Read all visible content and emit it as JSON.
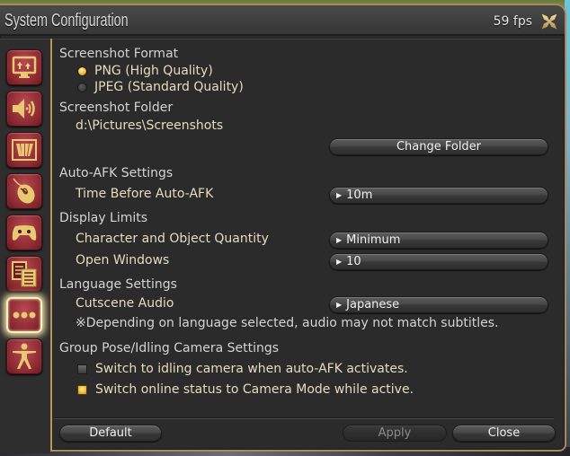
{
  "window": {
    "title": "System Configuration",
    "fps": "59 fps"
  },
  "sidebar": {
    "items": [
      {
        "name": "display-settings",
        "icon": "monitor-upload-icon",
        "active": false
      },
      {
        "name": "sound-settings",
        "icon": "speaker-icon",
        "active": false
      },
      {
        "name": "other-settings",
        "icon": "cards-icon",
        "active": false
      },
      {
        "name": "mouse-settings",
        "icon": "mouse-icon",
        "active": false
      },
      {
        "name": "gamepad-settings",
        "icon": "gamepad-icon",
        "active": false
      },
      {
        "name": "log-settings",
        "icon": "documents-icon",
        "active": false
      },
      {
        "name": "misc-settings",
        "icon": "ellipsis-icon",
        "active": true
      },
      {
        "name": "character-settings",
        "icon": "person-icon",
        "active": false
      }
    ]
  },
  "screenshot": {
    "format_heading": "Screenshot Format",
    "options": [
      {
        "label": "PNG (High Quality)",
        "selected": true
      },
      {
        "label": "JPEG (Standard Quality)",
        "selected": false
      }
    ],
    "folder_heading": "Screenshot Folder",
    "folder_path": "d:\\Pictures\\Screenshots",
    "change_folder_label": "Change Folder"
  },
  "afk": {
    "heading": "Auto-AFK Settings",
    "time_label": "Time Before Auto-AFK",
    "time_value": "10m"
  },
  "display_limits": {
    "heading": "Display Limits",
    "char_label": "Character and Object Quantity",
    "char_value": "Minimum",
    "windows_label": "Open Windows",
    "windows_value": "10"
  },
  "language": {
    "heading": "Language Settings",
    "cutscene_label": "Cutscene Audio",
    "cutscene_value": "Japanese",
    "note": "※Depending on language selected, audio may not match subtitles."
  },
  "camera": {
    "heading": "Group Pose/Idling Camera Settings",
    "options": [
      {
        "label": "Switch to idling camera when auto-AFK activates.",
        "checked": false
      },
      {
        "label": "Switch online status to Camera Mode while active.",
        "checked": true
      }
    ]
  },
  "footer": {
    "default_label": "Default",
    "apply_label": "Apply",
    "close_label": "Close"
  },
  "colors": {
    "accent_gold": "#b8935a",
    "category_red": "#8a2830",
    "radio_on": "#e0a820"
  }
}
